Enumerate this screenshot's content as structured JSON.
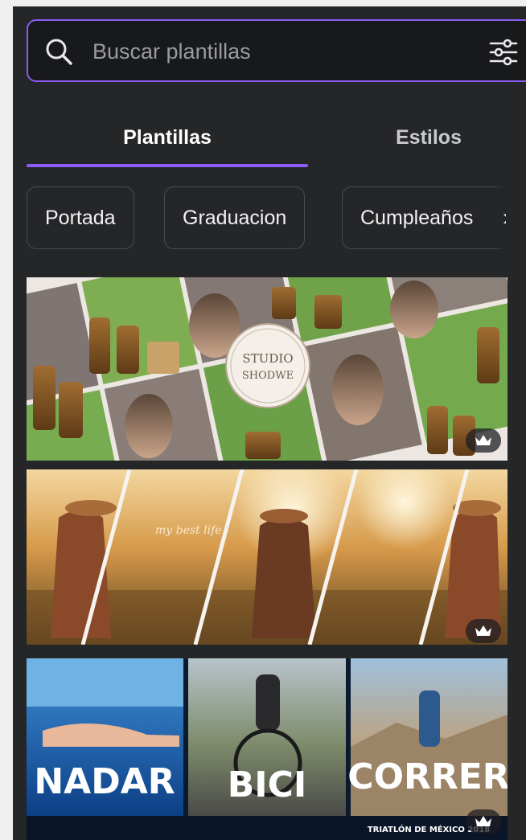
{
  "search": {
    "placeholder": "Buscar plantillas",
    "icon": "search-icon",
    "filter_icon": "sliders-icon"
  },
  "tabs": [
    {
      "label": "Plantillas",
      "active": true
    },
    {
      "label": "Estilos",
      "active": false
    }
  ],
  "chips": [
    {
      "label": "Portada"
    },
    {
      "label": "Graduacion"
    },
    {
      "label": "Cumpleaños"
    }
  ],
  "chip_next_icon": "chevron-right-icon",
  "templates": [
    {
      "badge": "STUDIO",
      "badge2": "SHODWE",
      "premium": true,
      "premium_icon": "crown-icon"
    },
    {
      "overlay_text": "my best life",
      "premium": true,
      "premium_icon": "crown-icon"
    },
    {
      "panels": [
        "NADAR",
        "BICI",
        "CORRER"
      ],
      "footer": "TRIATLÓN DE MÉXICO 2018",
      "premium": true,
      "premium_icon": "crown-icon"
    }
  ],
  "colors": {
    "accent": "#8b5cf6",
    "panel": "#252627",
    "search_bg": "#18191b"
  }
}
